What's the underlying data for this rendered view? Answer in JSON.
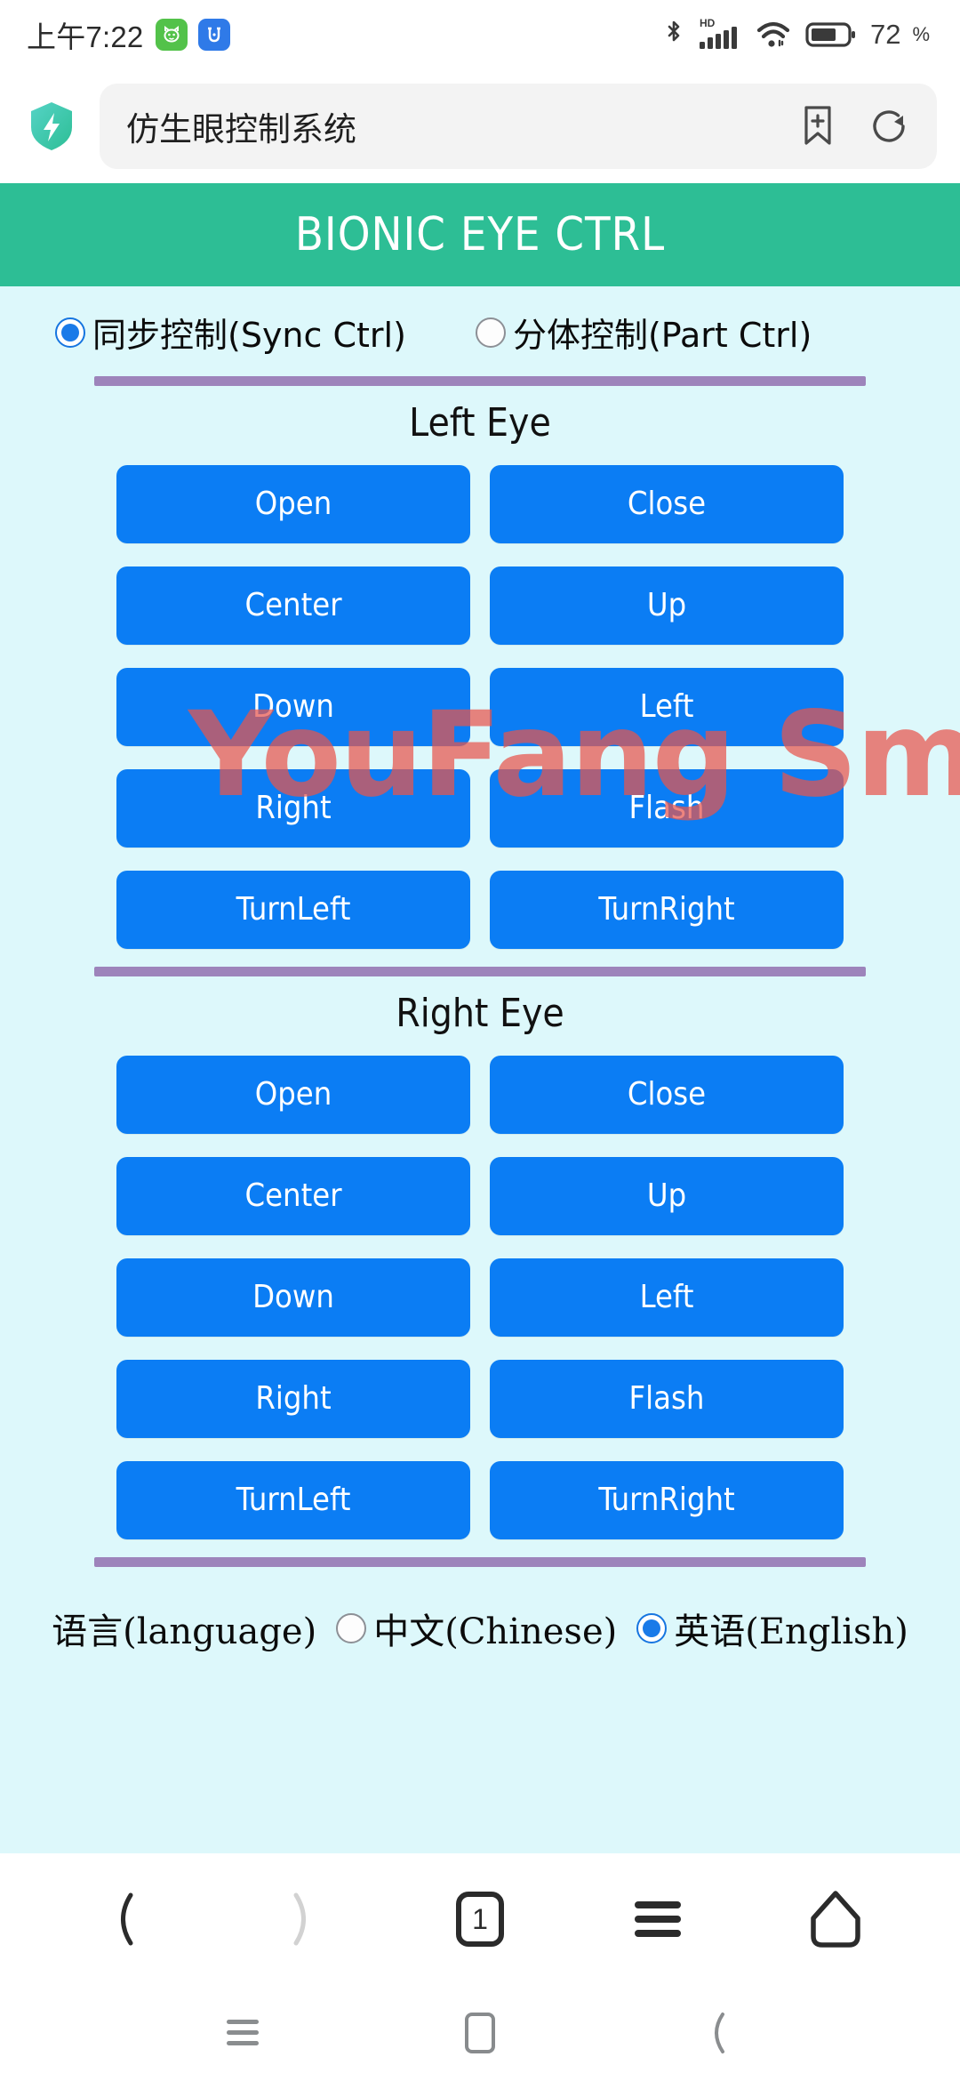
{
  "status_bar": {
    "time": "上午7:22",
    "app_icons": [
      "green-cat-app-icon",
      "blue-app-icon"
    ],
    "bluetooth_icon": "bluetooth-icon",
    "hd_label": "HD",
    "signal_icon": "signal-bars-icon",
    "wifi_icon": "wifi-icon",
    "battery_icon": "battery-icon",
    "battery_level": "72",
    "battery_unit": "%"
  },
  "browser": {
    "brand_icon": "shield-lightning-icon",
    "url_title": "仿生眼控制系统",
    "bookmark_add_icon": "bookmark-add-icon",
    "refresh_icon": "refresh-icon",
    "bottom_nav": {
      "back_icon": "chevron-left-icon",
      "forward_icon": "chevron-right-icon",
      "tab_count": "1",
      "menu_icon": "hamburger-menu-icon",
      "home_icon": "home-icon"
    }
  },
  "system_nav": {
    "recents_icon": "recents-icon",
    "home_icon": "home-square-icon",
    "back_icon": "back-chevron-icon"
  },
  "app": {
    "header_title": "BIONIC EYE CTRL",
    "watermark": "YouFang Smart",
    "modes": [
      {
        "label": "同步控制(Sync Ctrl)",
        "selected": true
      },
      {
        "label": "分体控制(Part Ctrl)",
        "selected": false
      }
    ],
    "sections": [
      {
        "title": "Left Eye",
        "buttons": [
          "Open",
          "Close",
          "Center",
          "Up",
          "Down",
          "Left",
          "Right",
          "Flash",
          "TurnLeft",
          "TurnRight"
        ]
      },
      {
        "title": "Right Eye",
        "buttons": [
          "Open",
          "Close",
          "Center",
          "Up",
          "Down",
          "Left",
          "Right",
          "Flash",
          "TurnLeft",
          "TurnRight"
        ]
      }
    ],
    "language": {
      "label": "语言(language)",
      "options": [
        {
          "label": "中文(Chinese)",
          "selected": false
        },
        {
          "label": "英语(English)",
          "selected": true
        }
      ]
    },
    "colors": {
      "header_green": "#2dbe95",
      "button_blue": "#0b7df4",
      "page_background": "#ddf8fb",
      "divider_purple": "#9d84bb",
      "radio_accent": "#1a7ae8",
      "watermark_red": "#e8544c"
    }
  }
}
